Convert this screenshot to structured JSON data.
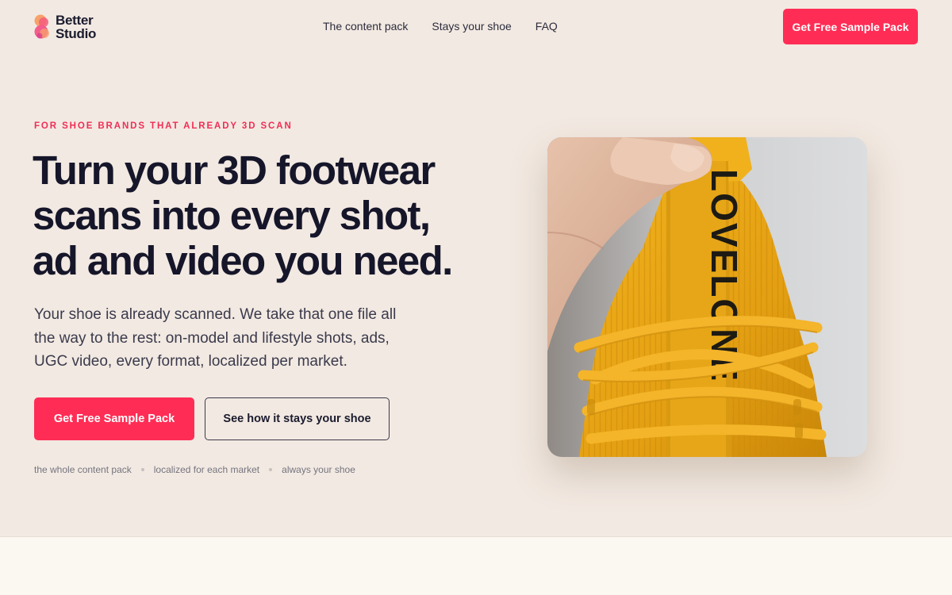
{
  "brand": {
    "line1": "Better",
    "line2": "Studio"
  },
  "nav": {
    "items": [
      "The content pack",
      "Stays your shoe",
      "FAQ"
    ],
    "cta": "Get Free Sample Pack"
  },
  "hero": {
    "eyebrow": "FOR SHOE BRANDS THAT ALREADY 3D SCAN",
    "headline": [
      "Turn your 3D footwear",
      "scans into every shot,",
      "ad and video you need."
    ],
    "lede": [
      "Your shoe is already scanned. We take that one file all",
      "the way to the rest: on-model and lifestyle shots, ads,",
      "UGC video, every format, localized per market."
    ],
    "primary_cta": "Get Free Sample Pack",
    "secondary_cta": "See how it stays your shoe",
    "features": [
      "the whole content pack",
      "localized for each market",
      "always your shoe"
    ],
    "image_text": "LOVELONE"
  },
  "colors": {
    "accent": "#ff2d55",
    "background": "#f2e9e2",
    "ink": "#16162a",
    "shoe_yellow": "#e8a516"
  }
}
